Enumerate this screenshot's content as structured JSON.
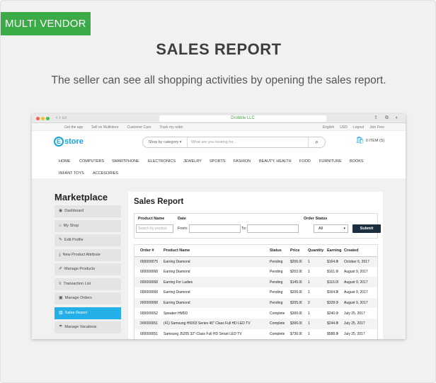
{
  "badge": "MULTI VENDOR",
  "hero": {
    "title": "SALES REPORT",
    "subtitle": "The seller can see all shopping activities by opening the sales report."
  },
  "browser": {
    "url": "Drobble LLC",
    "topbar_left": [
      "Get the app",
      "Sell on Multistore",
      "Customer Care",
      "Track my order"
    ],
    "topbar_right": [
      "English",
      "USD",
      "Logout",
      "Join Free"
    ]
  },
  "store": {
    "logo_letter": "E",
    "logo_text": "store",
    "search_category": "Shop by category",
    "search_placeholder": "What are you looking for...",
    "cart": "0 ITEM (S)",
    "menu_row1": [
      "HOME",
      "COMPUTERS",
      "SMARTPHONE",
      "ELECTRONICS",
      "JEWELRY",
      "SPORTS",
      "FASHION",
      "BEAUTY, HEALTH",
      "FOOD",
      "FURNITURE",
      "BOOKS"
    ],
    "menu_row2": [
      "INFANT TOYS",
      "ACCESORIES"
    ]
  },
  "sidebar": {
    "title": "Marketplace",
    "items": [
      {
        "label": "Dashboard",
        "icon": "dashboard-icon",
        "glyph": "◉"
      },
      {
        "label": "My Shop",
        "icon": "home-icon",
        "glyph": "⌂"
      },
      {
        "label": "Edit Profile",
        "icon": "edit-icon",
        "glyph": "✎"
      },
      {
        "label": "New Product Attribute",
        "icon": "download-icon",
        "glyph": "⤓"
      },
      {
        "label": "Manage Products",
        "icon": "edit-box-icon",
        "glyph": "✐"
      },
      {
        "label": "Transaction List",
        "icon": "list-icon",
        "glyph": "≡"
      },
      {
        "label": "Manage Orders",
        "icon": "orders-icon",
        "glyph": "▣"
      },
      {
        "label": "Sales Report",
        "icon": "chart-icon",
        "glyph": "▥"
      },
      {
        "label": "Manage Vacations",
        "icon": "vacation-icon",
        "glyph": "☂"
      }
    ],
    "active_index": 7
  },
  "report": {
    "title": "Sales Report",
    "filter": {
      "product_name_label": "Product Name",
      "product_name_placeholder": "Search by product",
      "date_label": "Date",
      "from_label": "From:",
      "to_label": "To:",
      "order_status_label": "Order Status",
      "order_status_value": "All",
      "submit_label": "Submit"
    },
    "columns": [
      "Order #",
      "Product Name",
      "Status",
      "Price",
      "Quantity",
      "Earning",
      "Created"
    ],
    "rows": [
      [
        "000000075",
        "Earring Diamond",
        "Pending",
        "$206.00",
        "1",
        "$164.80",
        "October 6, 2017"
      ],
      [
        "000000068",
        "Earring Diamond",
        "Pending",
        "$202.00",
        "1",
        "$161.60",
        "August 9, 2017"
      ],
      [
        "000000068",
        "Earring For Ladies",
        "Pending",
        "$145.00",
        "1",
        "$116.00",
        "August 9, 2017"
      ],
      [
        "000000068",
        "Earring Diamond",
        "Pending",
        "$206.00",
        "1",
        "$164.80",
        "August 9, 2017"
      ],
      [
        "000000068",
        "Earring Diamond",
        "Pending",
        "$205.00",
        "2",
        "$328.00",
        "August 9, 2017"
      ],
      [
        "000000052",
        "Speaker HM5D",
        "Complete",
        "$300.00",
        "1",
        "$240.00",
        "July 25, 2017"
      ],
      [
        "000000051",
        "(41) Samsung H5003 Series 40\" Class Full HD LED TV",
        "Complete",
        "$306.00",
        "1",
        "$244.80",
        "July 25, 2017"
      ],
      [
        "000000051",
        "Samsung J5205 32\"-Class Full HD Smart LED TV",
        "Complete",
        "$736.00",
        "1",
        "$588.80",
        "July 25, 2017"
      ]
    ]
  }
}
